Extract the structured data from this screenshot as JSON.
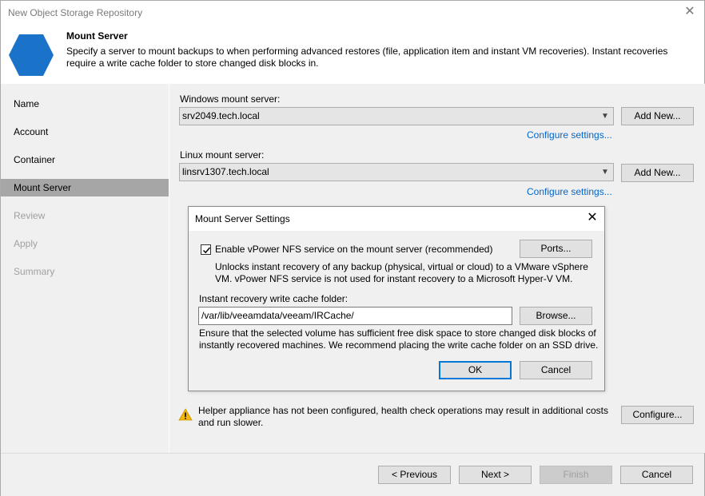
{
  "window": {
    "title": "New Object Storage Repository",
    "close_glyph": "✕"
  },
  "header": {
    "title": "Mount Server",
    "description": "Specify a server to mount backups to when performing advanced restores (file, application item and instant VM recoveries). Instant recoveries require a write cache folder to store changed disk blocks in.",
    "icon": "hexagon-icon",
    "icon_color": "#1a73c8"
  },
  "sidebar": {
    "steps": [
      {
        "label": "Name",
        "state": "done"
      },
      {
        "label": "Account",
        "state": "done"
      },
      {
        "label": "Container",
        "state": "done"
      },
      {
        "label": "Mount Server",
        "state": "active"
      },
      {
        "label": "Review",
        "state": "disabled"
      },
      {
        "label": "Apply",
        "state": "disabled"
      },
      {
        "label": "Summary",
        "state": "disabled"
      }
    ]
  },
  "main": {
    "windows_label": "Windows mount server:",
    "windows_value": "srv2049.tech.local",
    "windows_add": "Add New...",
    "windows_configure": "Configure settings...",
    "linux_label": "Linux mount server:",
    "linux_value": "linsrv1307.tech.local",
    "linux_add": "Add New...",
    "linux_configure": "Configure settings...",
    "warning_text": "Helper appliance has not been configured, health check operations may result in additional costs and run slower.",
    "configure_button": "Configure..."
  },
  "dialog": {
    "title": "Mount Server Settings",
    "close_glyph": "✕",
    "nfs_checkbox_label": "Enable vPower NFS service on the mount server (recommended)",
    "nfs_checked": true,
    "ports_button": "Ports...",
    "nfs_note": "Unlocks instant recovery of any backup (physical, virtual or cloud) to a VMware vSphere VM.  vPower NFS service is not used for instant recovery to a Microsoft Hyper-V VM.",
    "cache_label": "Instant recovery write cache folder:",
    "cache_value": "/var/lib/veeamdata/veeam/IRCache/",
    "browse_button": "Browse...",
    "cache_note": "Ensure that the selected volume has sufficient free disk space to store changed disk blocks of instantly recovered machines. We recommend placing the write cache folder on an SSD drive.",
    "ok_button": "OK",
    "cancel_button": "Cancel"
  },
  "footer": {
    "previous": "< Previous",
    "next": "Next >",
    "finish": "Finish",
    "cancel": "Cancel"
  },
  "colors": {
    "accent": "#0078d7",
    "link": "#0066cc",
    "warning": "#f2b705"
  }
}
